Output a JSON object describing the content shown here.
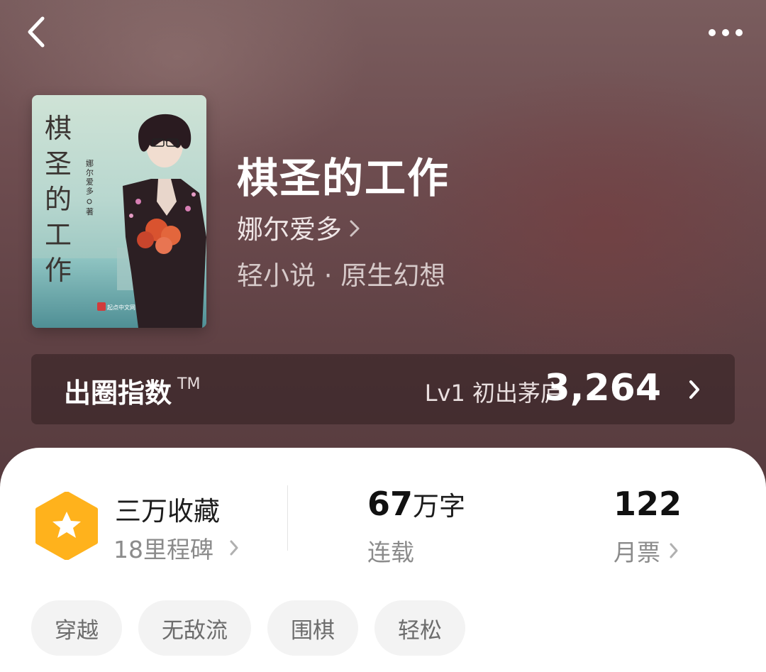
{
  "header": {
    "back_icon": "chevron-left-icon",
    "more_icon": "more-dots-icon"
  },
  "book": {
    "title": "棋圣的工作",
    "author": "娜尔爱多",
    "genre": "轻小说 · 原生幻想",
    "cover": {
      "title_calligraphy": "棋圣的工作",
      "author_vertical": "娜尔爱多",
      "author_suffix": "著",
      "publisher": "起点中文网"
    }
  },
  "index_bar": {
    "label": "出圈指数",
    "tm": "TM",
    "level": "Lv1 初出茅庐",
    "value": "3,264"
  },
  "stats": {
    "collection": {
      "title": "三万收藏",
      "subtitle": "18里程碑",
      "badge_icon": "star-hexagon-icon",
      "badge_color": "#ffb21c"
    },
    "words": {
      "number": "67",
      "unit": "万字",
      "status": "连载"
    },
    "monthly_tickets": {
      "number": "122",
      "label": "月票"
    }
  },
  "tags": [
    "穿越",
    "无敌流",
    "围棋",
    "轻松"
  ]
}
